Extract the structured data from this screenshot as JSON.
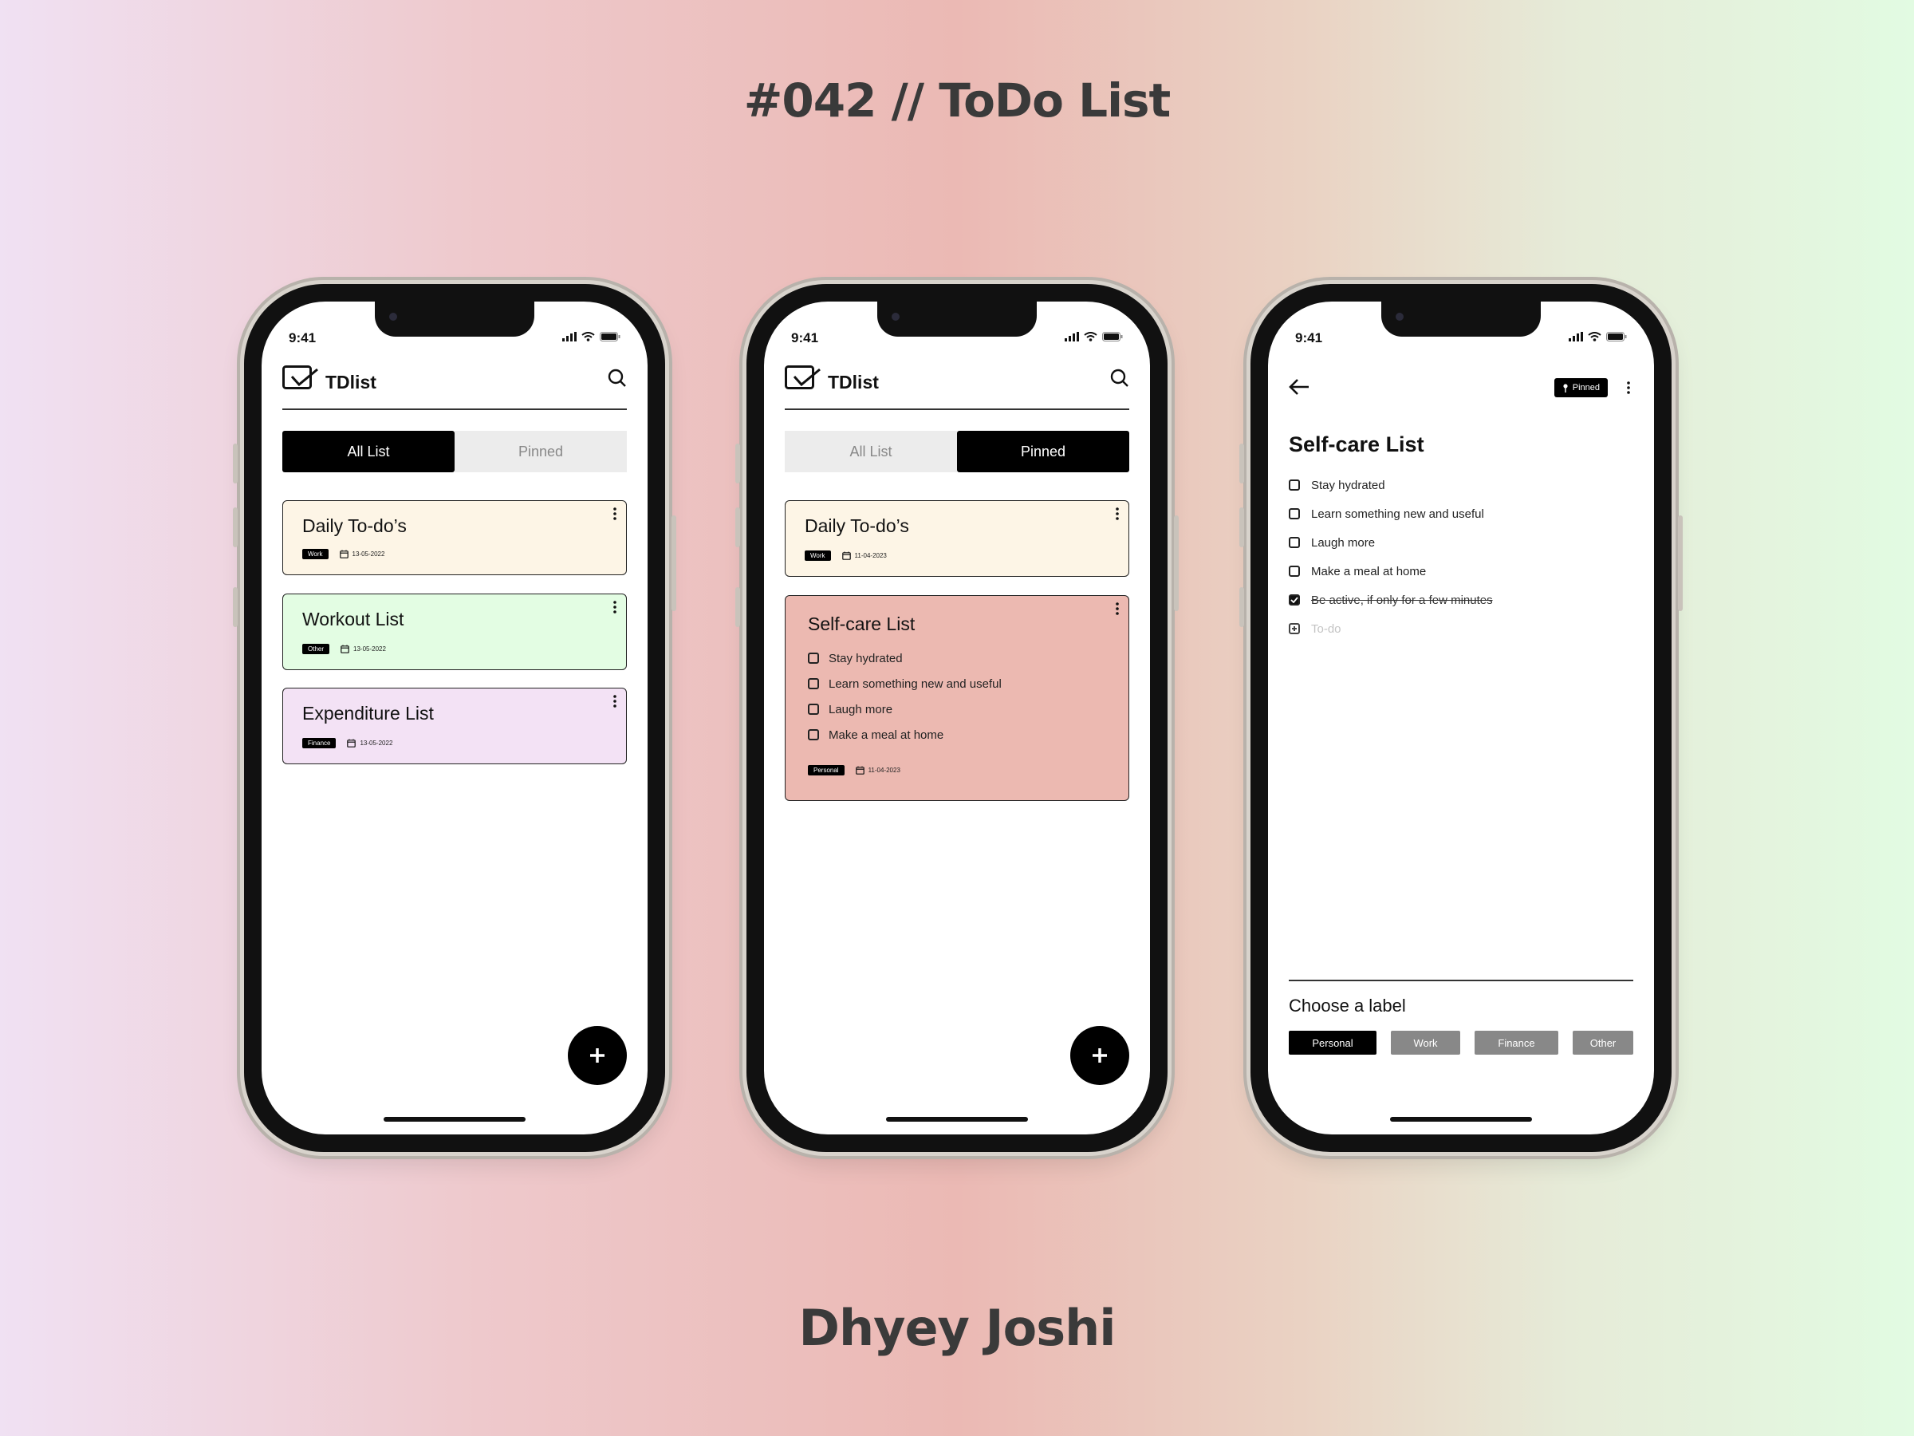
{
  "header": {
    "title": "#042 // ToDo List"
  },
  "footer": {
    "author": "Dhyey Joshi"
  },
  "status": {
    "time": "9:41"
  },
  "app": {
    "name": "TDlist"
  },
  "tabs": {
    "all": "All List",
    "pinned": "Pinned"
  },
  "screen1": {
    "cards": [
      {
        "title": "Daily To-do’s",
        "tag": "Work",
        "date": "13-05-2022",
        "color": "#fdf5e6"
      },
      {
        "title": "Workout List",
        "tag": "Other",
        "date": "13-05-2022",
        "color": "#e3fde3"
      },
      {
        "title": "Expenditure List",
        "tag": "Finance",
        "date": "13-05-2022",
        "color": "#f3e2f5"
      }
    ]
  },
  "screen2": {
    "card1": {
      "title": "Daily To-do’s",
      "tag": "Work",
      "date": "11-04-2023",
      "color": "#fdf5e6"
    },
    "card2": {
      "title": "Self-care List",
      "tag": "Personal",
      "date": "11-04-2023",
      "color": "#ecb9b1",
      "items": [
        "Stay hydrated",
        "Learn something new and useful",
        "Laugh more",
        "Make a meal at home"
      ]
    }
  },
  "screen3": {
    "badge": "Pinned",
    "title": "Self-care List",
    "items": [
      {
        "text": "Stay hydrated",
        "done": false
      },
      {
        "text": "Learn something new and useful",
        "done": false
      },
      {
        "text": "Laugh more",
        "done": false
      },
      {
        "text": "Make a meal at home",
        "done": false
      },
      {
        "text": "Be active, if only for a few minutes",
        "done": true
      }
    ],
    "add_placeholder": "To-do",
    "label_title": "Choose a label",
    "labels": [
      "Personal",
      "Work",
      "Finance",
      "Other"
    ],
    "selected_label": "Personal"
  },
  "icons": {
    "logo": "check-square-icon",
    "search": "search-icon",
    "menu": "kebab-menu-icon",
    "calendar": "calendar-icon",
    "add": "plus-icon",
    "back": "arrow-left-icon",
    "pin": "pin-icon"
  }
}
